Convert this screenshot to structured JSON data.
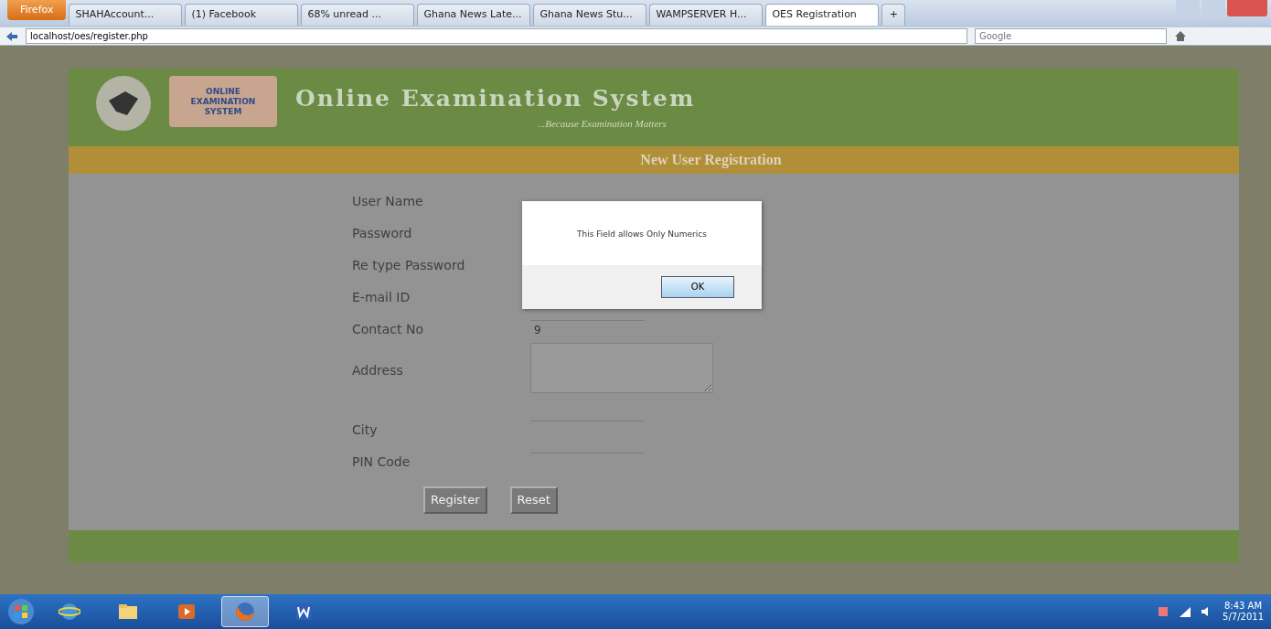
{
  "browser": {
    "menu_button": "Firefox",
    "tabs": [
      {
        "label": "SHAHAccount...",
        "selected": false
      },
      {
        "label": "(1) Facebook",
        "selected": false
      },
      {
        "label": "68% unread ...",
        "selected": false
      },
      {
        "label": "Ghana News Late...",
        "selected": false
      },
      {
        "label": "Ghana News Stu...",
        "selected": false
      },
      {
        "label": "WAMPSERVER H...",
        "selected": false
      },
      {
        "label": "OES Registration",
        "selected": true
      }
    ],
    "new_tab": "+",
    "address": "localhost/oes/register.php",
    "search_placeholder": "Google"
  },
  "page": {
    "logo_text": "ONLINE EXAMINATION SYSTEM",
    "title": "Online Examination System",
    "tagline": "...Because Examination Matters",
    "section_title": "New User Registration",
    "fields": [
      {
        "label": "User Name",
        "kind": "hidden"
      },
      {
        "label": "Password",
        "kind": "hidden"
      },
      {
        "label": "Re type Password",
        "kind": "hidden"
      },
      {
        "label": "E-mail ID",
        "kind": "hidden"
      },
      {
        "label": "Contact No",
        "kind": "text",
        "value": "9"
      },
      {
        "label": "Address",
        "kind": "textarea"
      },
      {
        "label": "City",
        "kind": "text"
      },
      {
        "label": "PIN Code",
        "kind": "text"
      }
    ],
    "buttons": [
      "Register",
      "Reset"
    ]
  },
  "alert": {
    "message": "This Field allows Only Numerics",
    "button": "OK"
  },
  "taskbar": {
    "apps": [
      {
        "kind": "ie",
        "selected": false
      },
      {
        "kind": "folder",
        "selected": false
      },
      {
        "kind": "media",
        "selected": false
      },
      {
        "kind": "firefox",
        "selected": true
      },
      {
        "kind": "word",
        "selected": false
      }
    ],
    "time": "8:43 AM",
    "date": "5/7/2011"
  }
}
